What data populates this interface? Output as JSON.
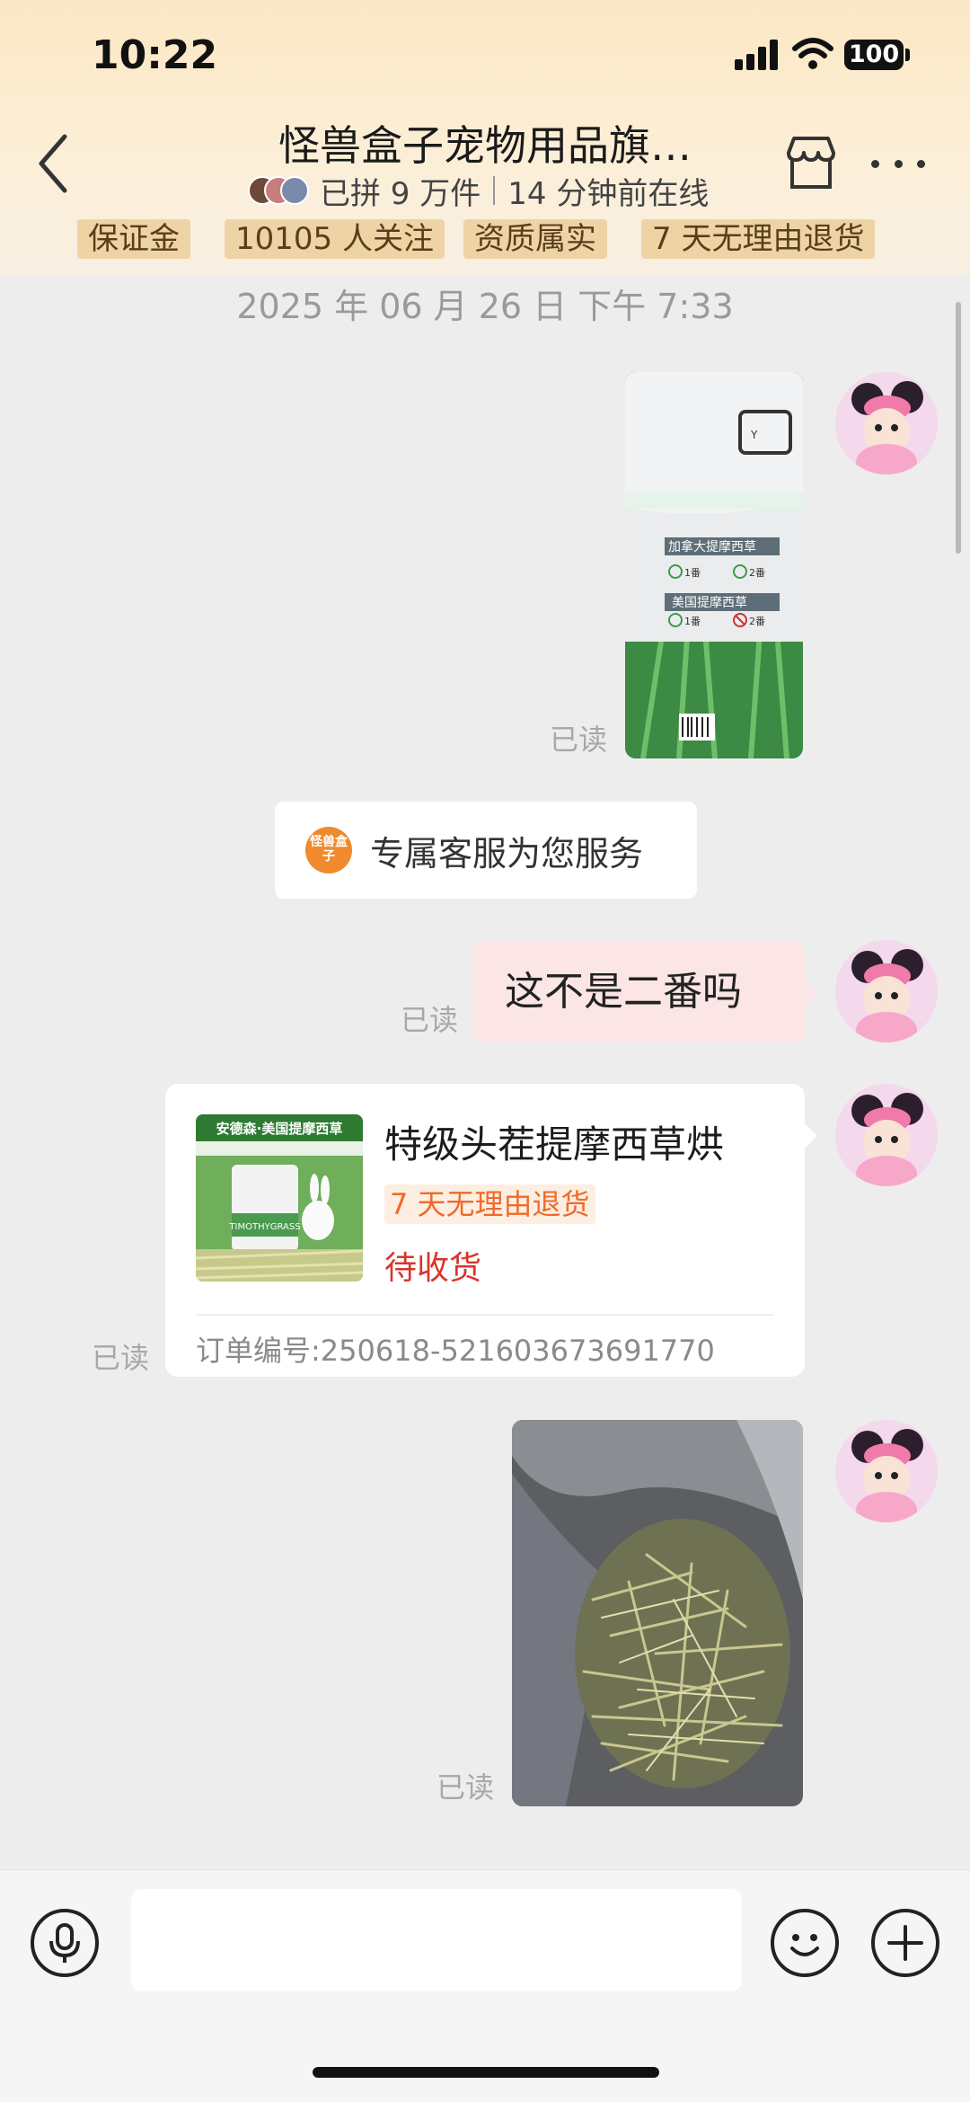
{
  "status_bar": {
    "time": "10:22",
    "battery": "100"
  },
  "header": {
    "title": "怪兽盒子宠物用品旗…",
    "sold": "已拼 9 万件",
    "online": "14 分钟前在线",
    "tags": [
      "保证金",
      "10105 人关注",
      "资质属实",
      "7 天无理由退货"
    ]
  },
  "chat": {
    "date": "2025 年 06 月 26 日 下午 7:33",
    "read_label": "已读",
    "service_logo": "怪兽盒子",
    "service_text": "专属客服为您服务",
    "message_text": "这不是二番吗",
    "photo1_text": {
      "title1": "加拿大提摩西草",
      "opt1": "1番",
      "opt2": "2番",
      "title2": "美国提摩西草",
      "opt3": "1番",
      "opt4": "2番"
    },
    "order": {
      "title": "特级头茬提摩西草烘",
      "badge": "7 天无理由退货",
      "status": "待收货",
      "order_no": "订单编号:250618-521603673691770",
      "thumb_banner": "安德森·美国提摩西草",
      "thumb_label": "TIMOTHYGRASS"
    }
  },
  "input": {
    "placeholder": ""
  }
}
